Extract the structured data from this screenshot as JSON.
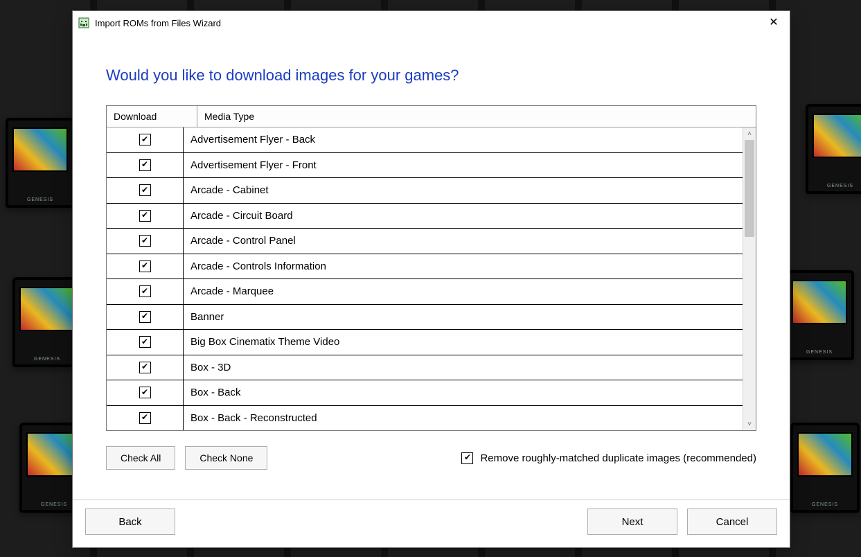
{
  "window": {
    "title": "Import ROMs from Files Wizard"
  },
  "heading": "Would you like to download images for your games?",
  "grid": {
    "columns": {
      "download": "Download",
      "media_type": "Media Type"
    },
    "rows": [
      {
        "checked": true,
        "label": "Advertisement Flyer - Back"
      },
      {
        "checked": true,
        "label": "Advertisement Flyer - Front"
      },
      {
        "checked": true,
        "label": "Arcade - Cabinet"
      },
      {
        "checked": true,
        "label": "Arcade - Circuit Board"
      },
      {
        "checked": true,
        "label": "Arcade - Control Panel"
      },
      {
        "checked": true,
        "label": "Arcade - Controls Information"
      },
      {
        "checked": true,
        "label": "Arcade - Marquee"
      },
      {
        "checked": true,
        "label": "Banner"
      },
      {
        "checked": true,
        "label": "Big Box Cinematix Theme Video"
      },
      {
        "checked": true,
        "label": "Box - 3D"
      },
      {
        "checked": true,
        "label": "Box - Back"
      },
      {
        "checked": true,
        "label": "Box - Back - Reconstructed"
      }
    ]
  },
  "buttons": {
    "check_all": "Check All",
    "check_none": "Check None",
    "back": "Back",
    "next": "Next",
    "cancel": "Cancel"
  },
  "options": {
    "remove_dupes": {
      "checked": true,
      "label": "Remove roughly-matched duplicate images (recommended)"
    }
  }
}
